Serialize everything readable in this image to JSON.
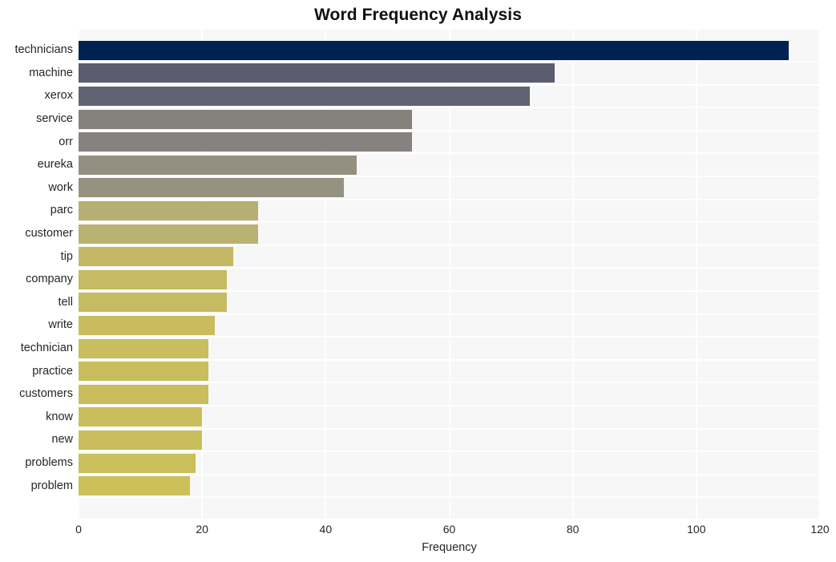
{
  "chart_data": {
    "type": "bar",
    "orientation": "horizontal",
    "title": "Word Frequency Analysis",
    "xlabel": "Frequency",
    "ylabel": "",
    "xlim": [
      0,
      120
    ],
    "xticks": [
      0,
      20,
      40,
      60,
      80,
      100,
      120
    ],
    "grid": true,
    "legend": null,
    "categories": [
      "technicians",
      "machine",
      "xerox",
      "service",
      "orr",
      "eureka",
      "work",
      "parc",
      "customer",
      "tip",
      "company",
      "tell",
      "write",
      "technician",
      "practice",
      "customers",
      "know",
      "new",
      "problems",
      "problem"
    ],
    "values": [
      115,
      77,
      73,
      54,
      54,
      45,
      43,
      29,
      29,
      25,
      24,
      24,
      22,
      21,
      21,
      21,
      20,
      20,
      19,
      18
    ],
    "bar_colors": [
      "#002250",
      "#5a5d70",
      "#5f6372",
      "#84837b",
      "#868280",
      "#949081",
      "#97927f",
      "#b6ae73",
      "#bab273",
      "#c4b864",
      "#c6ba62",
      "#c6ba62",
      "#c8bc5f",
      "#c9bd5e",
      "#c9bd5e",
      "#c9bd5e",
      "#cabe5c",
      "#cabe5c",
      "#cbbf5b",
      "#ccc059"
    ],
    "plot_background": "#f7f7f7",
    "gridline_color": "#ffffff",
    "page_background": "#ffffff",
    "text_color": "#262626"
  }
}
